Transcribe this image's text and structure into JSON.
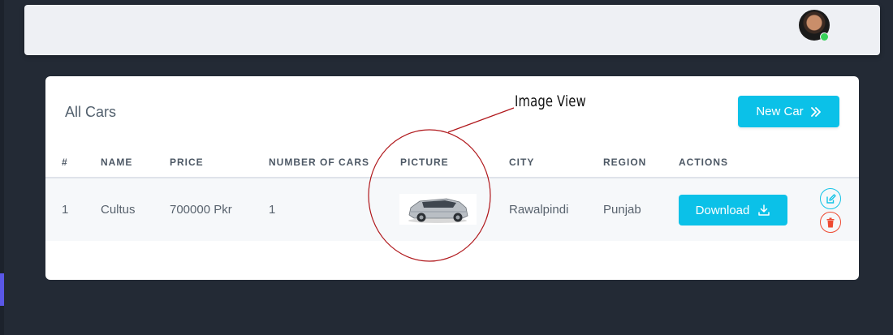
{
  "header": {
    "avatar_icon": "user-avatar",
    "status_color": "#37d159"
  },
  "card": {
    "title": "All Cars",
    "new_car_label": "New Car",
    "new_car_icon": "double-chevron-right-icon"
  },
  "table": {
    "columns": [
      "#",
      "NAME",
      "PRICE",
      "NUMBER OF CARS",
      "PICTURE",
      "CITY",
      "REGION",
      "ACTIONS"
    ],
    "rows": [
      {
        "index": "1",
        "name": "Cultus",
        "price": "700000 Pkr",
        "number_of_cars": "1",
        "picture_icon": "car-image",
        "city": "Rawalpindi",
        "region": "Punjab",
        "download_label": "Download",
        "download_icon": "download-icon",
        "edit_icon": "edit-icon",
        "delete_icon": "trash-icon"
      }
    ]
  },
  "annotation": {
    "label": "Image View",
    "color": "#b0181c"
  },
  "colors": {
    "accent": "#0bc1e8",
    "danger": "#ee4a32",
    "background": "#232a35"
  }
}
